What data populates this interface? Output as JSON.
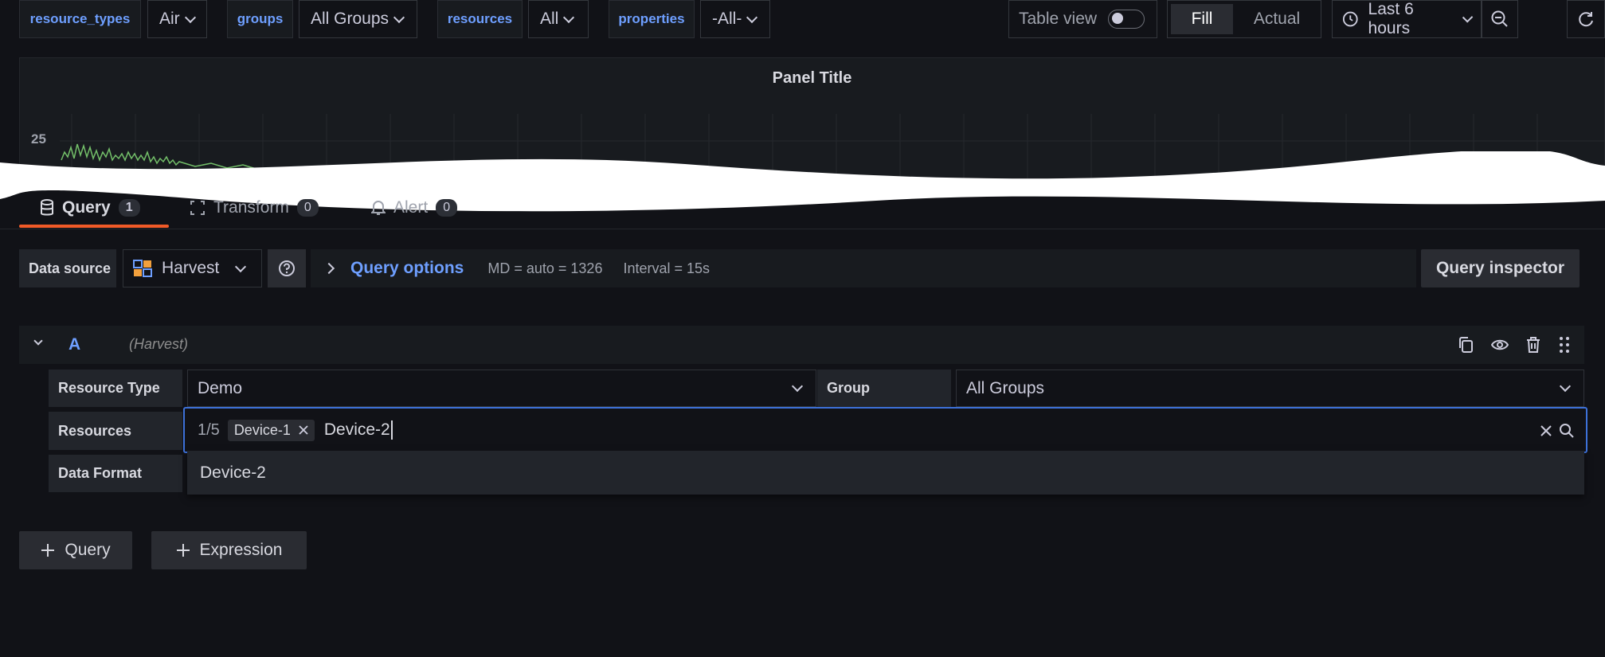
{
  "variables": [
    {
      "label": "resource_types",
      "value": "Air"
    },
    {
      "label": "groups",
      "value": "All Groups"
    },
    {
      "label": "resources",
      "value": "All"
    },
    {
      "label": "properties",
      "value": "-All-"
    }
  ],
  "toolbar": {
    "table_view_label": "Table view",
    "fill_label": "Fill",
    "actual_label": "Actual",
    "time_range": "Last 6 hours"
  },
  "panel": {
    "title": "Panel Title",
    "y_tick": "25"
  },
  "tabs": [
    {
      "label": "Query",
      "count": "1"
    },
    {
      "label": "Transform",
      "count": "0"
    },
    {
      "label": "Alert",
      "count": "0"
    }
  ],
  "datasource": {
    "label": "Data source",
    "value": "Harvest",
    "query_options_label": "Query options",
    "md_info": "MD = auto = 1326",
    "interval_info": "Interval = 15s",
    "inspector_label": "Query inspector"
  },
  "query_row": {
    "ref_id": "A",
    "source_name": "(Harvest)",
    "resource_type_label": "Resource Type",
    "resource_type_value": "Demo",
    "group_label": "Group",
    "group_value": "All Groups",
    "resources_label": "Resources",
    "resources_count": "1/5",
    "resources_chip": "Device-1",
    "resources_input": "Device-2",
    "data_format_label": "Data Format",
    "dropdown_option": "Device-2"
  },
  "actions": {
    "add_query_label": "Query",
    "add_expression_label": "Expression"
  },
  "colors": {
    "accent": "#6e9fff",
    "active_tab_underline": "#f05a28",
    "series": "#73bf69",
    "focus_border": "#3d71d9"
  }
}
